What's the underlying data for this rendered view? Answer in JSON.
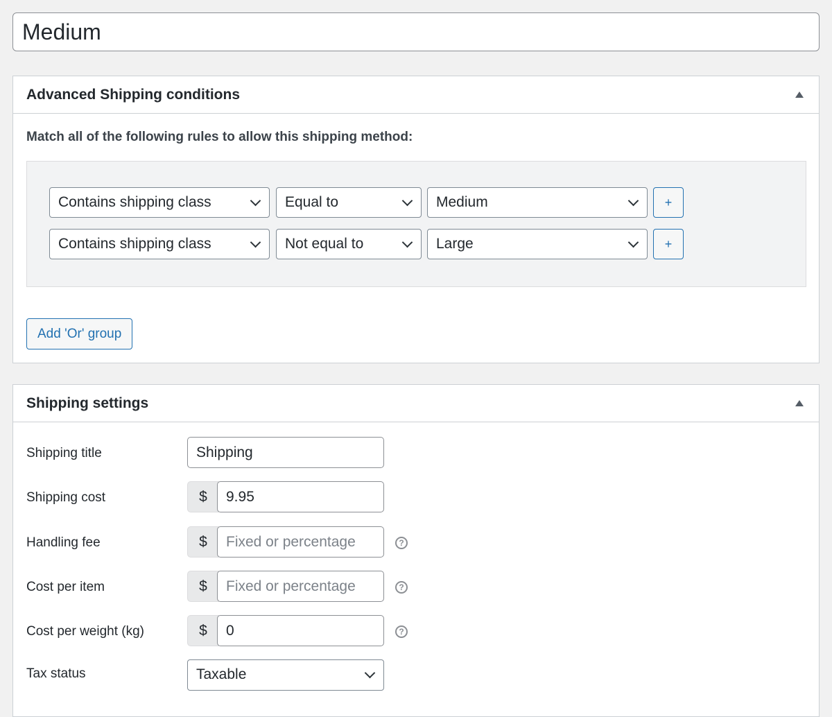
{
  "method_title": "Medium",
  "conditions": {
    "title": "Advanced Shipping conditions",
    "toggle_icon": "triangle-up-icon",
    "instruction": "Match all of the following rules to allow this shipping method:",
    "rules": [
      {
        "condition": "Contains shipping class",
        "operator": "Equal to",
        "value": "Medium",
        "add_label": "+"
      },
      {
        "condition": "Contains shipping class",
        "operator": "Not equal to",
        "value": "Large",
        "add_label": "+"
      }
    ],
    "add_or_group_label": "Add 'Or' group"
  },
  "settings": {
    "title": "Shipping settings",
    "toggle_icon": "triangle-up-icon",
    "currency_symbol": "$",
    "shipping_title": {
      "label": "Shipping title",
      "value": "Shipping"
    },
    "shipping_cost": {
      "label": "Shipping cost",
      "value": "9.95"
    },
    "handling_fee": {
      "label": "Handling fee",
      "placeholder": "Fixed or percentage",
      "help_icon": "question-circle-icon"
    },
    "cost_per_item": {
      "label": "Cost per item",
      "placeholder": "Fixed or percentage",
      "help_icon": "question-circle-icon"
    },
    "cost_per_weight": {
      "label": "Cost per weight (kg)",
      "value": "0",
      "help_icon": "question-circle-icon"
    },
    "tax_status": {
      "label": "Tax status",
      "value": "Taxable"
    }
  },
  "colors": {
    "accent": "#2271b1",
    "background": "#f1f1f1"
  }
}
